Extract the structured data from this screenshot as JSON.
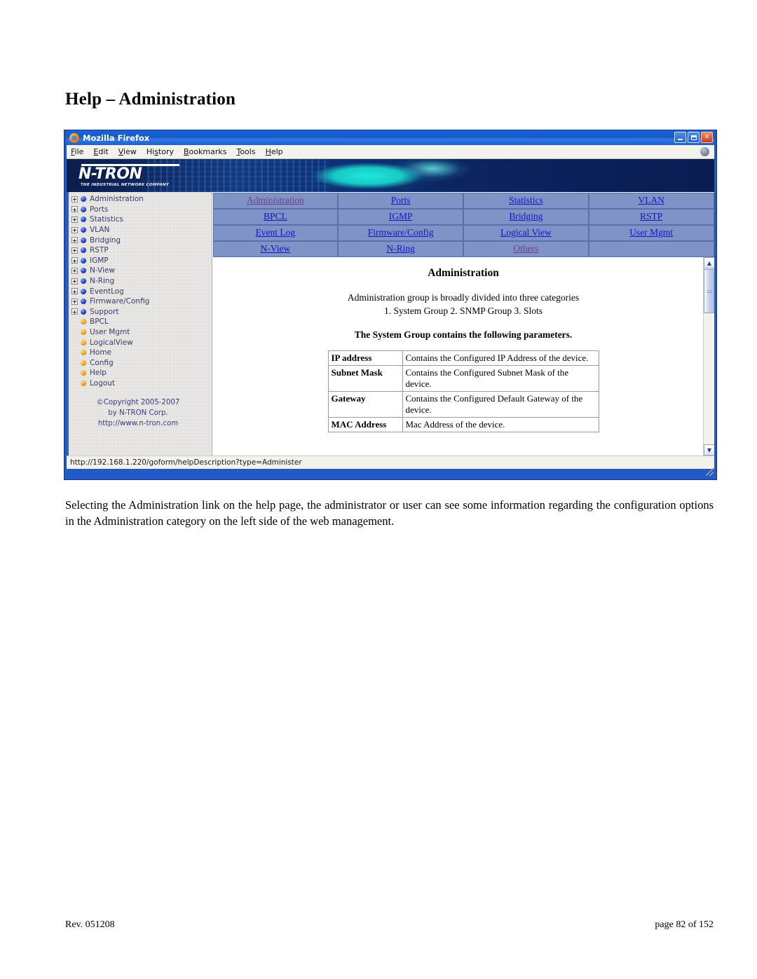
{
  "document": {
    "title": "Help – Administration",
    "paragraph": "Selecting the Administration link on the help page, the administrator or user can see some information regarding the configuration options in the Administration category on the left side of the web management.",
    "footer_left": "Rev.  051208",
    "footer_right": "page 82 of 152"
  },
  "browser": {
    "window_title": "Mozilla Firefox",
    "icon": "firefox-icon",
    "buttons": {
      "minimize": "_",
      "maximize": "□",
      "close": "✕"
    },
    "menu": [
      {
        "label": "File",
        "accesskey": "F"
      },
      {
        "label": "Edit",
        "accesskey": "E"
      },
      {
        "label": "View",
        "accesskey": "V"
      },
      {
        "label": "History",
        "accesskey": "s"
      },
      {
        "label": "Bookmarks",
        "accesskey": "B"
      },
      {
        "label": "Tools",
        "accesskey": "T"
      },
      {
        "label": "Help",
        "accesskey": "H"
      }
    ],
    "status_text": "http://192.168.1.220/goform/helpDescription?type=Administer"
  },
  "banner": {
    "logo_text": "N-TRON",
    "tagline": "THE INDUSTRIAL NETWORK COMPANY"
  },
  "sidebar": {
    "items": [
      {
        "label": "Administration",
        "bullet": "blue",
        "expandable": true
      },
      {
        "label": "Ports",
        "bullet": "blue",
        "expandable": true
      },
      {
        "label": "Statistics",
        "bullet": "blue",
        "expandable": true
      },
      {
        "label": "VLAN",
        "bullet": "blue",
        "expandable": true
      },
      {
        "label": "Bridging",
        "bullet": "blue",
        "expandable": true
      },
      {
        "label": "RSTP",
        "bullet": "blue",
        "expandable": true
      },
      {
        "label": "IGMP",
        "bullet": "blue",
        "expandable": true
      },
      {
        "label": "N-View",
        "bullet": "blue",
        "expandable": true
      },
      {
        "label": "N-Ring",
        "bullet": "blue",
        "expandable": true
      },
      {
        "label": "EventLog",
        "bullet": "blue",
        "expandable": true
      },
      {
        "label": "Firmware/Config",
        "bullet": "blue",
        "expandable": true
      },
      {
        "label": "Support",
        "bullet": "blue",
        "expandable": true
      },
      {
        "label": "BPCL",
        "bullet": "orange",
        "expandable": false
      },
      {
        "label": "User Mgmt",
        "bullet": "orange",
        "expandable": false
      },
      {
        "label": "LogicalView",
        "bullet": "orange",
        "expandable": false
      },
      {
        "label": "Home",
        "bullet": "orange",
        "expandable": false
      },
      {
        "label": "Config",
        "bullet": "orange",
        "expandable": false
      },
      {
        "label": "Help",
        "bullet": "orange",
        "expandable": false
      },
      {
        "label": "Logout",
        "bullet": "orange",
        "expandable": false
      }
    ],
    "copyright": {
      "line1": "©Copyright 2005-2007",
      "line2": "by N-TRON Corp.",
      "line3": "http://www.n-tron.com"
    }
  },
  "nav_table": {
    "rows": [
      [
        {
          "label": "Administration",
          "visited": true
        },
        {
          "label": "Ports",
          "visited": false
        },
        {
          "label": "Statistics",
          "visited": false
        },
        {
          "label": "VLAN",
          "visited": false
        }
      ],
      [
        {
          "label": "BPCL",
          "visited": false
        },
        {
          "label": "IGMP",
          "visited": false
        },
        {
          "label": "Bridging",
          "visited": false
        },
        {
          "label": "RSTP",
          "visited": false
        }
      ],
      [
        {
          "label": "Event Log",
          "visited": false
        },
        {
          "label": "Firmware/Config",
          "visited": false
        },
        {
          "label": "Logical View",
          "visited": false
        },
        {
          "label": "User Mgmt",
          "visited": false
        }
      ],
      [
        {
          "label": "N-View",
          "visited": false
        },
        {
          "label": "N-Ring",
          "visited": false
        },
        {
          "label": "Others",
          "visited": true
        },
        {
          "label": "",
          "visited": false
        }
      ]
    ]
  },
  "help": {
    "title": "Administration",
    "intro_line1": "Administration group is broadly divided into three categories",
    "intro_line2": "1. System Group   2. SNMP Group   3. Slots",
    "subtitle": "The System Group contains the following parameters.",
    "parameters": [
      {
        "name": "IP address",
        "description": "Contains the Configured IP Address of the device."
      },
      {
        "name": "Subnet Mask",
        "description": "Contains the Configured Subnet Mask of the device."
      },
      {
        "name": "Gateway",
        "description": "Contains the Configured Default Gateway of the device."
      },
      {
        "name": "MAC Address",
        "description": "Mac Address of the device."
      }
    ]
  },
  "colors": {
    "nav_cell_bg": "#7f93c6",
    "link": "#1414c8",
    "link_visited": "#6d3f8f",
    "banner_dark": "#0b1d4a",
    "banner_flame": "#20e8da",
    "sidebar_bg": "#d4d0c8",
    "titlebar_blue": "#1758c9"
  }
}
